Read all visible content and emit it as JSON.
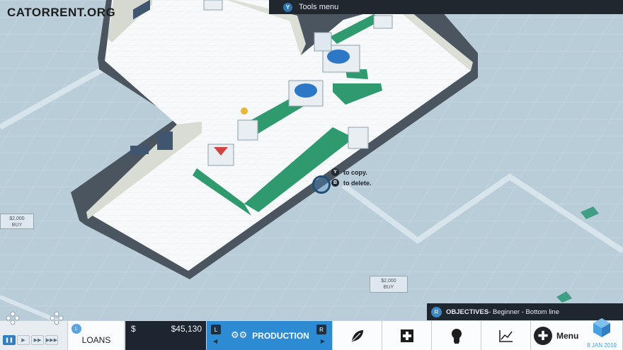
{
  "watermark": "CATORRENT.ORG",
  "tools_hint": {
    "button": "Y",
    "label": "Tools menu"
  },
  "plots": [
    {
      "price": "$2,000",
      "action": "BUY"
    },
    {
      "price": "$2,000",
      "action": "BUY"
    }
  ],
  "copy_hint": {
    "copy_button": "Y",
    "copy_text": "to copy.",
    "delete_button": "B",
    "delete_text": "to delete."
  },
  "objectives": {
    "button": "R",
    "title": "OBJECTIVES",
    "text": " - Beginner - Bottom line"
  },
  "hud": {
    "loans_badge": "L",
    "loans_label": "LOANS",
    "currency": "$",
    "money": "$45,130",
    "prod_left_button": "L",
    "prod_right_button": "R",
    "production_label": "PRODUCTION",
    "menu_label": "Menu",
    "date": "8 JAN 2019"
  },
  "icons": [
    "leaf-icon",
    "plus-icon",
    "lightbulb-icon",
    "chart-icon",
    "menu-plus-icon"
  ],
  "colors": {
    "accent": "#2d8bd4",
    "dark": "#1e2630",
    "belt": "#2f9a6e",
    "floor": "#f7f9fa"
  }
}
